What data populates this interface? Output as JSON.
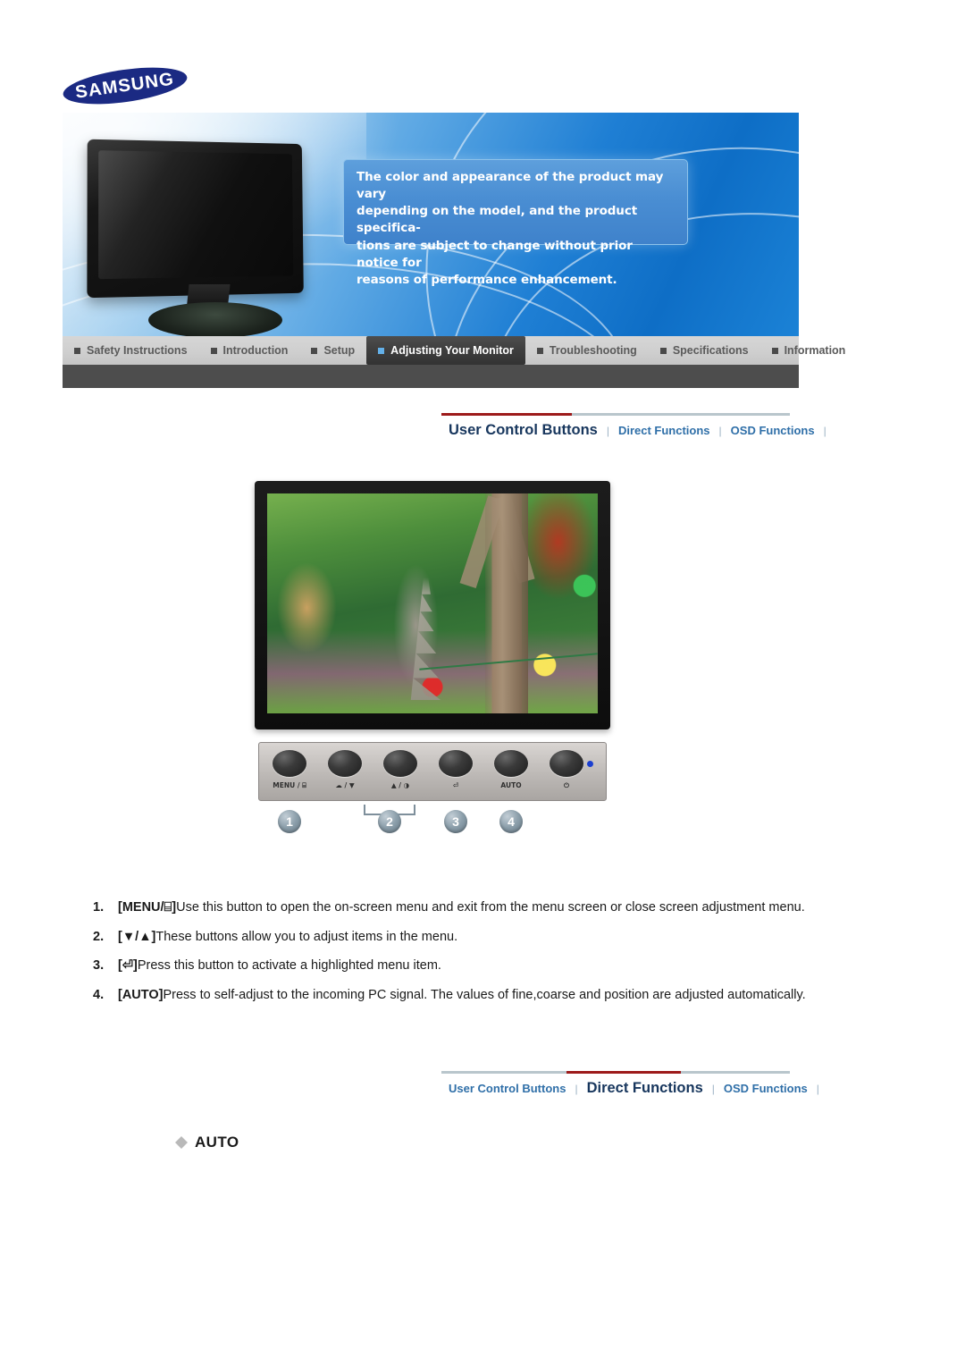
{
  "brand": {
    "logo_text": "SAMSUNG"
  },
  "banner": {
    "notice": "The color and appearance of the product may vary\ndepending on the model, and the product specifica-\ntions are subject to change without prior notice for\nreasons of performance enhancement."
  },
  "main_nav": {
    "items": [
      {
        "label": "Safety Instructions",
        "active": false
      },
      {
        "label": "Introduction",
        "active": false
      },
      {
        "label": "Setup",
        "active": false
      },
      {
        "label": "Adjusting Your Monitor",
        "active": true
      },
      {
        "label": "Troubleshooting",
        "active": false
      },
      {
        "label": "Specifications",
        "active": false
      },
      {
        "label": "Information",
        "active": false
      }
    ]
  },
  "subnav_top": {
    "items": [
      {
        "label": "User Control Buttons",
        "active": true
      },
      {
        "label": "Direct Functions",
        "active": false
      },
      {
        "label": "OSD Functions",
        "active": false
      }
    ],
    "separator": "|"
  },
  "subnav_bottom": {
    "items": [
      {
        "label": "User Control Buttons",
        "active": false
      },
      {
        "label": "Direct Functions",
        "active": true
      },
      {
        "label": "OSD Functions",
        "active": false
      }
    ],
    "separator": "|"
  },
  "control_panel": {
    "buttons": [
      {
        "label": "MENU / ⌸"
      },
      {
        "label": "☁ / ▼"
      },
      {
        "label": "▲ / ◑"
      },
      {
        "label": "⏎"
      },
      {
        "label": "AUTO"
      },
      {
        "label": "⏻"
      }
    ],
    "led_color": "#1b3fd0",
    "callouts": [
      "1",
      "2",
      "3",
      "4"
    ]
  },
  "instructions": [
    {
      "num": "1.",
      "key": "[MENU/⌸]",
      "text": "Use this button to open the on-screen menu and exit from the menu screen or close screen adjustment menu."
    },
    {
      "num": "2.",
      "key": "[▼/▲]",
      "text": "These buttons allow you to adjust items in the menu."
    },
    {
      "num": "3.",
      "key": "[⏎]",
      "text": "Press this button to activate a highlighted menu item."
    },
    {
      "num": "4.",
      "key": "[AUTO]",
      "text": "Press to self-adjust to the incoming PC signal. The values of fine,coarse and position are adjusted automatically."
    }
  ],
  "section_heading": {
    "label": "AUTO"
  },
  "colors": {
    "brand_blue": "#1b2a83",
    "active_tab_dark": "#3b3b3b",
    "subnav_active_rule": "#9d1a1a",
    "subnav_link": "#2f6fa8",
    "subnav_active_text": "#17365d",
    "led_blue": "#1b3fd0"
  }
}
